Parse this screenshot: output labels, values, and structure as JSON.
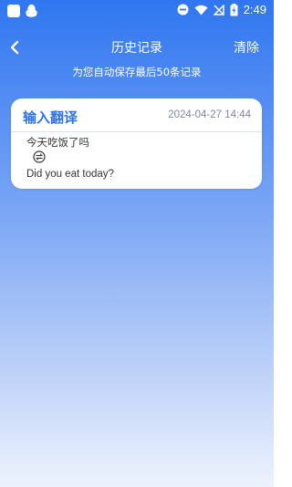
{
  "status_bar": {
    "time": "2:49",
    "icons": [
      "app-square-icon",
      "qq-penguin-icon",
      "do-not-disturb-icon",
      "wifi-icon",
      "no-sim-signal-icon",
      "battery-charging-icon"
    ]
  },
  "header": {
    "title": "历史记录",
    "clear_label": "清除",
    "back_icon": "chevron-left-icon",
    "subtitle": "为您自动保存最后50条记录"
  },
  "history": [
    {
      "label": "输入翻译",
      "timestamp": "2024-04-27 14:44",
      "source_text": "今天吃饭了吗",
      "swap_icon": "swap-arrows-icon",
      "translated_text": "Did you eat today?"
    }
  ],
  "colors": {
    "primary": "#2F76F0",
    "accent_text": "#2D73E8",
    "card_bg": "#FFFFFF",
    "muted_text": "#7F8A99"
  }
}
